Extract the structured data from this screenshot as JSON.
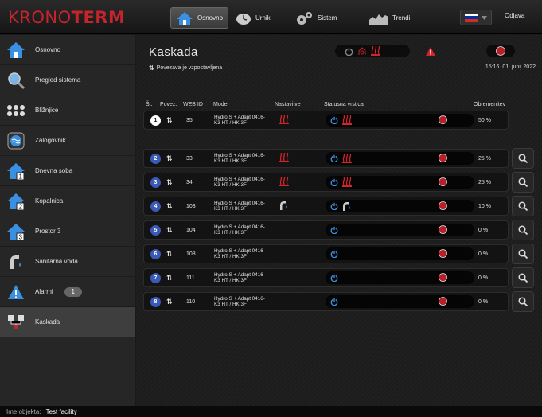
{
  "logo": {
    "part1": "KRONO",
    "part2": "TERM"
  },
  "nav": [
    {
      "label": "Osnovno",
      "icon": "home-icon"
    },
    {
      "label": "Urniki",
      "icon": "clock-icon"
    },
    {
      "label": "Sistem",
      "icon": "gears-icon"
    },
    {
      "label": "Trendi",
      "icon": "chart-icon"
    }
  ],
  "logout_label": "Odjava",
  "sidebar": {
    "items": [
      {
        "label": "Osnovno",
        "icon": "home-icon"
      },
      {
        "label": "Pregled sistema",
        "icon": "magnifier-icon"
      },
      {
        "label": "Bližnjice",
        "icon": "shortcuts-icon"
      },
      {
        "label": "Zalogovnik",
        "icon": "buffer-tank-icon"
      },
      {
        "label": "Dnevna soba",
        "icon": "room-1-icon"
      },
      {
        "label": "Kopalnica",
        "icon": "room-2-icon"
      },
      {
        "label": "Prostor 3",
        "icon": "room-3-icon"
      },
      {
        "label": "Sanitarna voda",
        "icon": "tap-icon"
      },
      {
        "label": "Alarmi",
        "icon": "alarm-icon",
        "badge": "1"
      },
      {
        "label": "Kaskada",
        "icon": "cascade-icon",
        "active": true
      }
    ]
  },
  "main": {
    "title": "Kaskada",
    "connection": "Povezava je vzpostavljena",
    "time": "15:16",
    "date": "01. junij 2022"
  },
  "table": {
    "headers": {
      "st": "Št.",
      "povez": "Povez.",
      "webid": "WEB ID",
      "model": "Model",
      "nastavitve": "Nastavitve",
      "status": "Statusna vrstica",
      "obremenitev": "Obremenitev"
    },
    "rows": [
      {
        "num": "1",
        "webid": "35",
        "model1": "Hydro S + Adapt 0416-",
        "model2": "K3 HT / HK 3F",
        "setting": "heating",
        "load": "50 %"
      },
      {
        "num": "2",
        "webid": "33",
        "model1": "Hydro S + Adapt 0416-",
        "model2": "K3 HT / HK 3F",
        "setting": "heating",
        "load": "25 %"
      },
      {
        "num": "3",
        "webid": "34",
        "model1": "Hydro S + Adapt 0416-",
        "model2": "K3 HT / HK 3F",
        "setting": "heating",
        "load": "25 %"
      },
      {
        "num": "4",
        "webid": "103",
        "model1": "Hydro S + Adapt 0416-",
        "model2": "K3 HT / HK 3F",
        "setting": "tap",
        "load": "10 %"
      },
      {
        "num": "5",
        "webid": "104",
        "model1": "Hydro S + Adapt 0416-",
        "model2": "K3 HT / HK 3F",
        "setting": "none",
        "load": "0 %"
      },
      {
        "num": "6",
        "webid": "108",
        "model1": "Hydro S + Adapt 0416-",
        "model2": "K3 HT / HK 3F",
        "setting": "none",
        "load": "0 %"
      },
      {
        "num": "7",
        "webid": "111",
        "model1": "Hydro S + Adapt 0416-",
        "model2": "K3 HT / HK 3F",
        "setting": "none",
        "load": "0 %"
      },
      {
        "num": "8",
        "webid": "110",
        "model1": "Hydro S + Adapt 0416-",
        "model2": "K3 HT / HK 3F",
        "setting": "none",
        "load": "0 %"
      }
    ]
  },
  "footer": {
    "label": "Ime objekta:",
    "value": "Test facility"
  },
  "colors": {
    "brand": "#c4242b",
    "accent": "#3a8fe0",
    "heat": "#d2242b",
    "number": "#3a5bb5"
  }
}
